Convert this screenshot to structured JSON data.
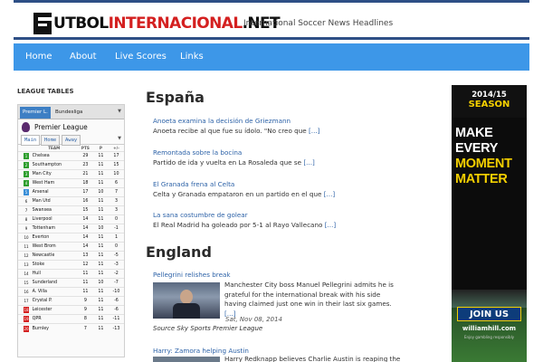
{
  "header": {
    "logo_prefix": "UTBOL",
    "logo_red": "INTERNACIONAL",
    "logo_suffix": ".NET",
    "tagline": "International Soccer News Headlines"
  },
  "nav": {
    "items": [
      "Home",
      "About",
      "Live Scores",
      "Links"
    ]
  },
  "sidebar": {
    "heading": "LEAGUE TABLES",
    "tabs": [
      "Premier L.",
      "Bundesliga"
    ],
    "league_name": "Premier League",
    "subtabs": [
      "Main",
      "Home",
      "Away"
    ],
    "columns": [
      "TEAM",
      "PTS",
      "P",
      "+/-"
    ],
    "rows": [
      {
        "pos": "1",
        "team": "Chelsea",
        "pts": "29",
        "p": "11",
        "gd": "17",
        "color": "#2e9e2e"
      },
      {
        "pos": "2",
        "team": "Southampton",
        "pts": "23",
        "p": "11",
        "gd": "15",
        "color": "#2e9e2e"
      },
      {
        "pos": "3",
        "team": "Man City",
        "pts": "21",
        "p": "11",
        "gd": "10",
        "color": "#2e9e2e"
      },
      {
        "pos": "4",
        "team": "West Ham",
        "pts": "18",
        "p": "11",
        "gd": "6",
        "color": "#2e9e2e"
      },
      {
        "pos": "5",
        "team": "Arsenal",
        "pts": "17",
        "p": "10",
        "gd": "7",
        "color": "#3a8fd8"
      },
      {
        "pos": "6",
        "team": "Man Utd",
        "pts": "16",
        "p": "11",
        "gd": "3",
        "color": ""
      },
      {
        "pos": "7",
        "team": "Swansea",
        "pts": "15",
        "p": "11",
        "gd": "3",
        "color": ""
      },
      {
        "pos": "8",
        "team": "Liverpool",
        "pts": "14",
        "p": "11",
        "gd": "0",
        "color": ""
      },
      {
        "pos": "9",
        "team": "Tottenham",
        "pts": "14",
        "p": "10",
        "gd": "-1",
        "color": ""
      },
      {
        "pos": "10",
        "team": "Everton",
        "pts": "14",
        "p": "11",
        "gd": "1",
        "color": ""
      },
      {
        "pos": "11",
        "team": "West Brom",
        "pts": "14",
        "p": "11",
        "gd": "0",
        "color": ""
      },
      {
        "pos": "12",
        "team": "Newcastle",
        "pts": "13",
        "p": "11",
        "gd": "-5",
        "color": ""
      },
      {
        "pos": "13",
        "team": "Stoke",
        "pts": "12",
        "p": "11",
        "gd": "-3",
        "color": ""
      },
      {
        "pos": "14",
        "team": "Hull",
        "pts": "11",
        "p": "11",
        "gd": "-2",
        "color": ""
      },
      {
        "pos": "15",
        "team": "Sunderland",
        "pts": "11",
        "p": "10",
        "gd": "-7",
        "color": ""
      },
      {
        "pos": "16",
        "team": "A. Villa",
        "pts": "11",
        "p": "11",
        "gd": "-10",
        "color": ""
      },
      {
        "pos": "17",
        "team": "Crystal P.",
        "pts": "9",
        "p": "11",
        "gd": "-6",
        "color": ""
      },
      {
        "pos": "18",
        "team": "Leicester",
        "pts": "9",
        "p": "11",
        "gd": "-6",
        "color": "#d42020"
      },
      {
        "pos": "19",
        "team": "QPR",
        "pts": "8",
        "p": "11",
        "gd": "-11",
        "color": "#d42020"
      },
      {
        "pos": "20",
        "team": "Burnley",
        "pts": "7",
        "p": "11",
        "gd": "-13",
        "color": "#d42020"
      }
    ]
  },
  "espana": {
    "title": "España",
    "items": [
      {
        "headline": "Anoeta examina la decisión de Griezmann",
        "summary": "Anoeta recibe al que fue su ídolo. \"No creo que",
        "more": "[...]"
      },
      {
        "headline": "Remontada sobre la bocina",
        "summary": "Partido de ida y vuelta en La Rosaleda que se",
        "more": "[...]"
      },
      {
        "headline": "El Granada frena al Celta",
        "summary": "Celta y Granada empataron en un partido en el que",
        "more": "[...]"
      },
      {
        "headline": "La sana costumbre de golear",
        "summary": "El Real Madrid ha goleado por 5-1 al Rayo Vallecano",
        "more": "[...]"
      }
    ]
  },
  "england": {
    "title": "England",
    "featured": {
      "headline": "Pellegrini relishes break",
      "body": "Manchester City boss Manuel Pellegrini admits he is grateful for the international break with his side having claimed just one win in their last six games.",
      "more": "[...]",
      "date": "Sat, Nov 08, 2014",
      "source": "Source Sky Sports Premier League"
    },
    "second": {
      "headline": "Harry: Zamora helping Austin",
      "body": "Harry Redknapp believes Charlie Austin is reaping the"
    }
  },
  "ad": {
    "year": "2014/15",
    "season": "SEASON",
    "slogan_white": [
      "MAKE",
      "EVERY"
    ],
    "slogan_yellow": [
      "MOMENT",
      "MATTER"
    ],
    "cta": "JOIN US",
    "site": "williamhill.com",
    "resp": "Enjoy gambling responsibly"
  }
}
